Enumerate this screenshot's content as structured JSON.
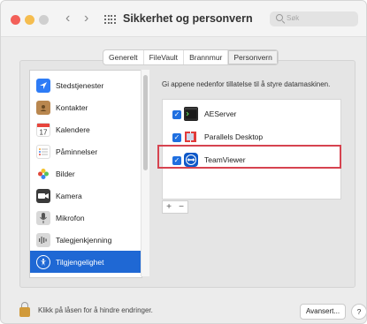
{
  "window": {
    "title": "Sikkerhet og personvern",
    "nav_back": "‹",
    "nav_forward": "›",
    "search_placeholder": "Søk"
  },
  "tabs": [
    {
      "label": "Generelt",
      "active": false
    },
    {
      "label": "FileVault",
      "active": false
    },
    {
      "label": "Brannmur",
      "active": false
    },
    {
      "label": "Personvern",
      "active": true
    }
  ],
  "sidebar": {
    "items": [
      {
        "label": "Stedstjenester",
        "icon": "location-arrow-icon",
        "color": "#2e7cf6",
        "selected": false
      },
      {
        "label": "Kontakter",
        "icon": "contacts-book-icon",
        "color": "#b9874f",
        "selected": false
      },
      {
        "label": "Kalendere",
        "icon": "calendar-icon",
        "color": "#ffffff",
        "selected": false
      },
      {
        "label": "Påminnelser",
        "icon": "reminders-list-icon",
        "color": "#ffffff",
        "selected": false
      },
      {
        "label": "Bilder",
        "icon": "photos-flower-icon",
        "color": "#ffffff",
        "selected": false
      },
      {
        "label": "Kamera",
        "icon": "camera-icon",
        "color": "#3a3a3a",
        "selected": false
      },
      {
        "label": "Mikrofon",
        "icon": "microphone-icon",
        "color": "#d8d8d8",
        "selected": false
      },
      {
        "label": "Talegjenkjenning",
        "icon": "waveform-icon",
        "color": "#d8d8d8",
        "selected": false
      },
      {
        "label": "Tilgjengelighet",
        "icon": "accessibility-icon",
        "color": "#1f68d4",
        "selected": true
      }
    ]
  },
  "main": {
    "description": "Gi appene nedenfor tillatelse til å styre datamaskinen.",
    "apps": [
      {
        "name": "AEServer",
        "icon": "terminal-icon",
        "checked": true,
        "highlighted": false
      },
      {
        "name": "Parallels Desktop",
        "icon": "parallels-icon",
        "checked": true,
        "highlighted": false
      },
      {
        "name": "TeamViewer",
        "icon": "teamviewer-icon",
        "checked": true,
        "highlighted": true
      }
    ],
    "add_label": "+",
    "remove_label": "−"
  },
  "bottom": {
    "lock_text": "Klikk på låsen for å hindre endringer.",
    "advanced_label": "Avansert...",
    "help_label": "?"
  }
}
